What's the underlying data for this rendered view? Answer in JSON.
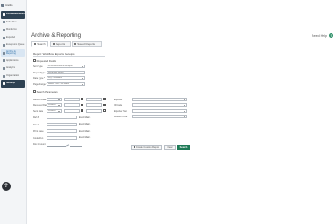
{
  "app": {
    "brand_label": "Intellio",
    "page_title": "Archive & Reporting",
    "need_help_label": "Need Help",
    "help_fab_label": "?"
  },
  "sidebar": {
    "items": [
      {
        "label": "Portal Dashboard"
      },
      {
        "label": "Schedules"
      },
      {
        "label": "Monitoring"
      },
      {
        "label": "Exported"
      },
      {
        "label": "Exceptions Queue"
      },
      {
        "label": "Archive & Reporting"
      },
      {
        "label": "Applications"
      },
      {
        "label": "Analytics"
      },
      {
        "label": "Organization"
      },
      {
        "label": "Settings"
      }
    ]
  },
  "tabs": [
    {
      "label": "Search"
    },
    {
      "label": "Reports"
    },
    {
      "label": "Saved Reports"
    }
  ],
  "report": {
    "line": "Report: Workflow Exports Receipts"
  },
  "sections": {
    "request_fields": "Requested Fields",
    "search_parameters": "Search Parameters"
  },
  "request_fields": [
    {
      "label": "Sort Type",
      "value": "All Work Content Receipts"
    },
    {
      "label": "Report Type",
      "value": "Document Level"
    },
    {
      "label": "Date Type *",
      "value": "Any - All Dates"
    },
    {
      "label": "Page Range *",
      "value": "Select Here - All Dates"
    }
  ],
  "search_params": {
    "left": [
      {
        "label": "Receipt Date",
        "select": "Custom"
      },
      {
        "label": "Received Date",
        "select": "Custom"
      },
      {
        "label": "Sent Date",
        "select": "Custom"
      },
      {
        "label": "Ref #",
        "exact": "Exact Match"
      },
      {
        "label": "Doc #",
        "exact": "Exact Match"
      },
      {
        "label": "Print Case",
        "exact": "Exact Match"
      },
      {
        "label": "Code Run",
        "exact": "Exact Match"
      },
      {
        "label": "Doc Amount"
      }
    ],
    "right": [
      {
        "label": "Exporter"
      },
      {
        "label": "ID Code"
      },
      {
        "label": "Exporter Stat"
      },
      {
        "label": "Reason Code"
      }
    ]
  },
  "buttons": {
    "create_custom": "Create Custom Report",
    "clear": "Clear",
    "search": "Search"
  }
}
